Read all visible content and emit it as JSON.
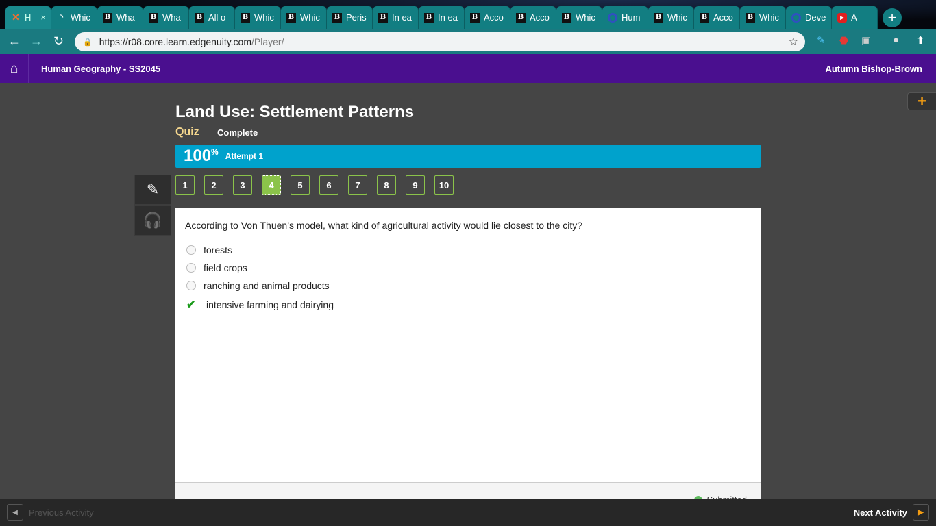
{
  "browser": {
    "tabs": [
      {
        "label": "H",
        "icon": "edgenuity-icon"
      },
      {
        "label": "Whic",
        "icon": "loading-icon"
      },
      {
        "label": "Wha",
        "icon": "b-icon"
      },
      {
        "label": "Wha",
        "icon": "b-icon"
      },
      {
        "label": "All o",
        "icon": "b-icon"
      },
      {
        "label": "Whic",
        "icon": "b-icon"
      },
      {
        "label": "Whic",
        "icon": "b-icon"
      },
      {
        "label": "Peris",
        "icon": "b-icon"
      },
      {
        "label": "In ea",
        "icon": "b-icon"
      },
      {
        "label": "In ea",
        "icon": "b-icon"
      },
      {
        "label": "Acco",
        "icon": "b-icon"
      },
      {
        "label": "Acco",
        "icon": "b-icon"
      },
      {
        "label": "Whic",
        "icon": "b-icon"
      },
      {
        "label": "Hum",
        "icon": "q-icon"
      },
      {
        "label": "Whic",
        "icon": "b-icon"
      },
      {
        "label": "Acco",
        "icon": "b-icon"
      },
      {
        "label": "Whic",
        "icon": "b-icon"
      },
      {
        "label": "Deve",
        "icon": "q-icon"
      },
      {
        "label": "A",
        "icon": "youtube-icon"
      }
    ],
    "url_host": "https://r08.core.learn.edgenuity.com",
    "url_path": "/Player/"
  },
  "header": {
    "course": "Human Geography - SS2045",
    "user": "Autumn Bishop-Brown"
  },
  "activity": {
    "title": "Land Use: Settlement Patterns",
    "type": "Quiz",
    "status": "Complete",
    "score": "100",
    "score_unit": "%",
    "attempt": "Attempt 1"
  },
  "questions": [
    "1",
    "2",
    "3",
    "4",
    "5",
    "6",
    "7",
    "8",
    "9",
    "10"
  ],
  "current_question": "4",
  "question": {
    "text": "According to Von Thuen’s model, what kind of agricultural activity would lie closest to the city?",
    "options": [
      {
        "label": "forests",
        "selected": false
      },
      {
        "label": "field crops",
        "selected": false
      },
      {
        "label": "ranching and animal products",
        "selected": false
      },
      {
        "label": "intensive farming and dairying",
        "selected": true
      }
    ],
    "status": "Submitted"
  },
  "footer": {
    "prev": "Previous Activity",
    "next": "Next Activity"
  },
  "colors": {
    "header": "#4a0f8f",
    "score_bar": "#00a2cc",
    "question_nav": "#8bc34a",
    "quiz": "#f5d78e"
  }
}
